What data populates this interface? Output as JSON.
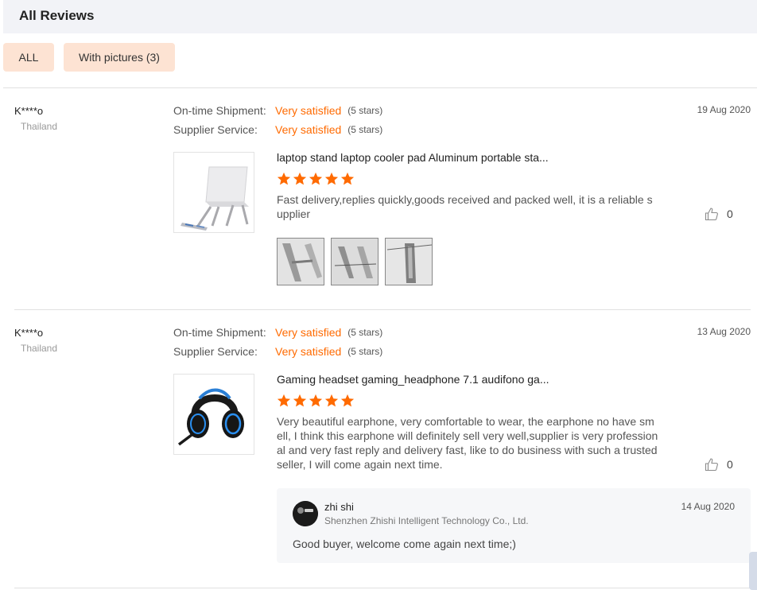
{
  "header": {
    "title": "All Reviews"
  },
  "filters": {
    "all_label": "ALL",
    "pictures_label": "With pictures (3)"
  },
  "colors": {
    "accent": "#ff6a00",
    "filter_bg": "#fde3d3",
    "header_bg": "#f2f3f7"
  },
  "reviews": [
    {
      "buyer": "K****o",
      "country": "Thailand",
      "date": "19 Aug 2020",
      "shipment_label": "On-time Shipment:",
      "shipment_value": "Very satisfied",
      "shipment_stars": "(5 stars)",
      "service_label": "Supplier Service:",
      "service_value": "Very satisfied",
      "service_stars": "(5 stars)",
      "product_title": "laptop stand laptop cooler pad Aluminum portable sta...",
      "product_rating": 5,
      "text": "Fast delivery,replies quickly,goods received and packed well, it is a reliable supplier",
      "helpful_count": "0",
      "picture_count": 3
    },
    {
      "buyer": "K****o",
      "country": "Thailand",
      "date": "13 Aug 2020",
      "shipment_label": "On-time Shipment:",
      "shipment_value": "Very satisfied",
      "shipment_stars": "(5 stars)",
      "service_label": "Supplier Service:",
      "service_value": "Very satisfied",
      "service_stars": "(5 stars)",
      "product_title": "Gaming headset gaming_headphone 7.1 audifono ga...",
      "product_rating": 5,
      "text": "Very beautiful earphone, very comfortable to wear, the earphone no have smell, I think this earphone will definitely sell very well,supplier is very professional and very fast reply and delivery fast, like to do business with such a trusted seller, I will come again next time.",
      "helpful_count": "0",
      "reply": {
        "name": "zhi shi",
        "company": "Shenzhen Zhishi Intelligent Technology Co., Ltd.",
        "date": "14 Aug 2020",
        "text": "Good buyer, welcome come again next time;)"
      }
    }
  ]
}
